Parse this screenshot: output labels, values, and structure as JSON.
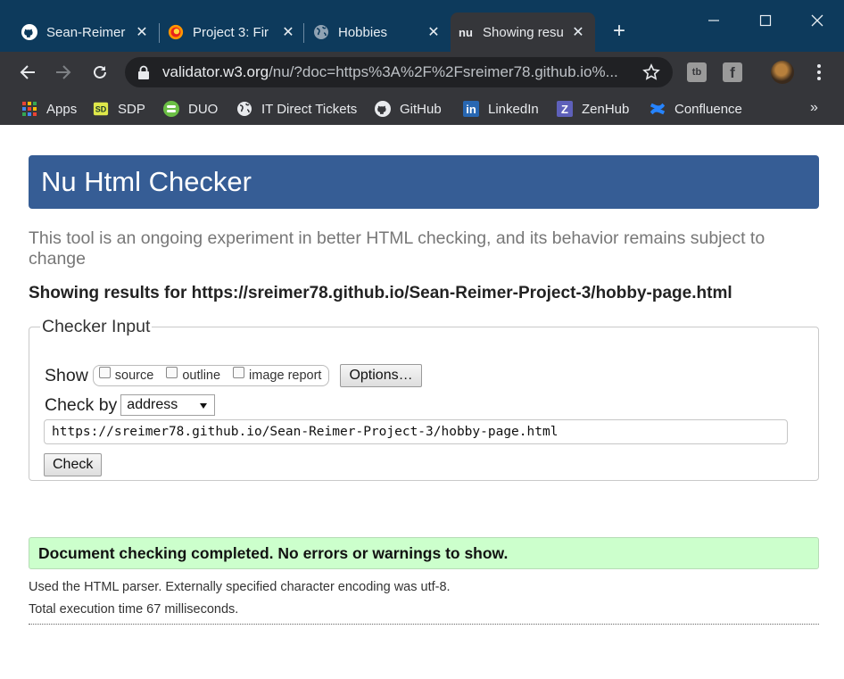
{
  "browser": {
    "tabs": [
      {
        "title": "Sean-Reimer",
        "icon": "github-icon",
        "active": false
      },
      {
        "title": "Project 3: Fir",
        "icon": "firefox-icon",
        "active": false
      },
      {
        "title": "Hobbies",
        "icon": "globe-icon",
        "active": false
      },
      {
        "title": "Showing resu",
        "icon": "nu-icon",
        "icon_text": "nu",
        "active": true
      }
    ],
    "url_host": "validator.w3.org",
    "url_rest": "/nu/?doc=https%3A%2F%2Fsreimer78.github.io%...",
    "bookmarks": [
      {
        "label": "Apps",
        "icon": "apps-grid-icon"
      },
      {
        "label": "SDP",
        "icon": "sdp-icon"
      },
      {
        "label": "DUO",
        "icon": "duo-icon"
      },
      {
        "label": "IT Direct Tickets",
        "icon": "globe-icon"
      },
      {
        "label": "GitHub",
        "icon": "github-icon"
      },
      {
        "label": "LinkedIn",
        "icon": "linkedin-icon",
        "icon_text": "in"
      },
      {
        "label": "ZenHub",
        "icon": "zenhub-icon",
        "icon_text": "Z"
      },
      {
        "label": "Confluence",
        "icon": "confluence-icon"
      }
    ],
    "more_bookmarks": "»",
    "extensions": [
      {
        "icon": "tb-extension-icon",
        "icon_text": "tb"
      },
      {
        "icon": "facebook-extension-icon",
        "icon_text": "f"
      }
    ]
  },
  "page": {
    "title": "Nu Html Checker",
    "intro": "This tool is an ongoing experiment in better HTML checking, and its behavior remains subject to change",
    "showing_results": "Showing results for https://sreimer78.github.io/Sean-Reimer-Project-3/hobby-page.html",
    "checker": {
      "legend": "Checker Input",
      "show_label": "Show",
      "show_options": [
        "source",
        "outline",
        "image report"
      ],
      "options_button": "Options…",
      "check_by_label": "Check by",
      "check_by_value": "address",
      "url_value": "https://sreimer78.github.io/Sean-Reimer-Project-3/hobby-page.html",
      "check_button": "Check"
    },
    "result_message": "Document checking completed. No errors or warnings to show.",
    "parser_info": "Used the HTML parser. Externally specified character encoding was utf-8.",
    "execution_time": "Total execution time 67 milliseconds."
  },
  "colors": {
    "title_bar": "#0d3a5c",
    "toolbar": "#35363a",
    "header_bar": "#365d95",
    "success_bg": "#ccffcc"
  }
}
